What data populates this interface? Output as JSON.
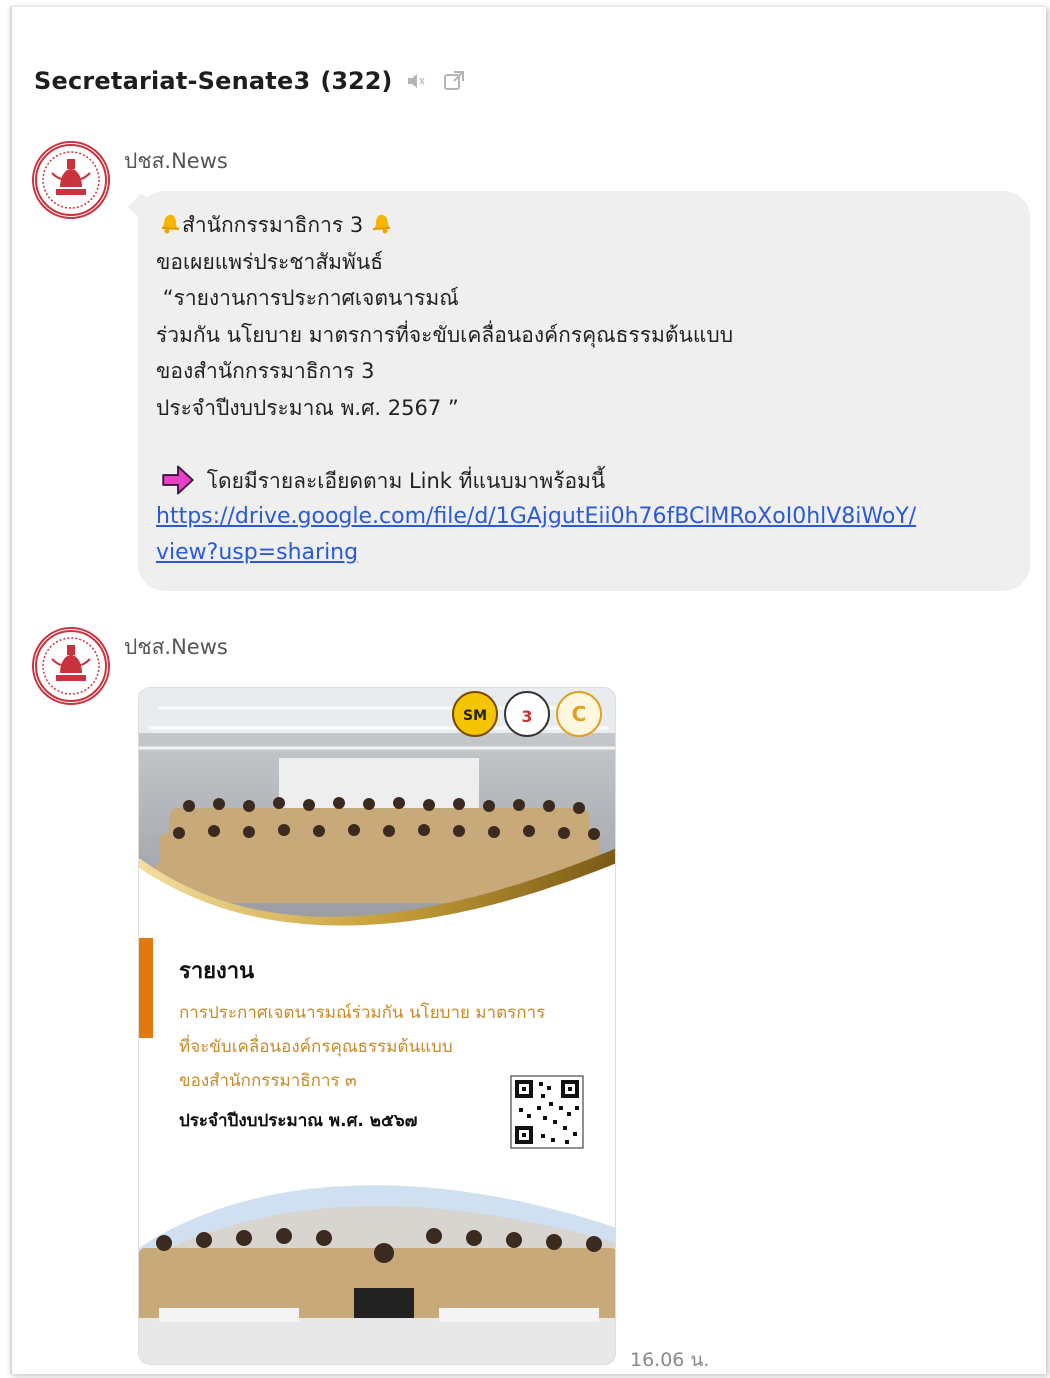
{
  "header": {
    "title": "Secretariat-Senate3",
    "member_count": "(322)"
  },
  "messages": [
    {
      "sender": "ปชส.News",
      "lines": [
        "สำนักกรรมาธิการ 3",
        "ขอเผยแพร่ประชาสัมพันธ์",
        " “รายงานการประกาศเจตนารมณ์",
        "ร่วมกัน นโยบาย มาตรการที่จะขับเคลื่อนองค์กรคุณธรรมต้นแบบ",
        "ของสำนักกรรมาธิการ 3",
        "ประจำปีงบประมาณ พ.ศ. 2567 ”",
        "โดยมีรายละเอียดตาม Link ที่แนบมาพร้อมนี้"
      ],
      "link_line1": "https://drive.google.com/file/d/1GAjgutEii0h76fBClMRoXoI0hlV8iWoY/",
      "link_line2": "view?usp=sharing"
    },
    {
      "sender": "ปชส.News",
      "poster": {
        "badge_number": "3",
        "heading": "รายงาน",
        "line1": "การประกาศเจตนารมณ์ร่วมกัน นโยบาย มาตรการ",
        "line2": "ที่จะขับเคลื่อนองค์กรคุณธรรมต้นแบบ",
        "line3": "ของสำนักกรรมาธิการ ๓",
        "fiscal": "ประจำปีงบประมาณ พ.ศ. ๒๕๖๗"
      },
      "time": "16.06 น."
    }
  ],
  "colors": {
    "link": "#2a5bd7",
    "bubble": "#efefef",
    "poster_orange": "#e07a10",
    "poster_gold": "#c9a13b",
    "avatar_red": "#c9333f",
    "arrow_magenta": "#e93fc7"
  },
  "icons": {
    "mute": "speaker-muted-icon",
    "open_external": "external-window-icon",
    "bell": "bell-emoji-icon",
    "arrow": "right-arrow-emoji-icon"
  }
}
